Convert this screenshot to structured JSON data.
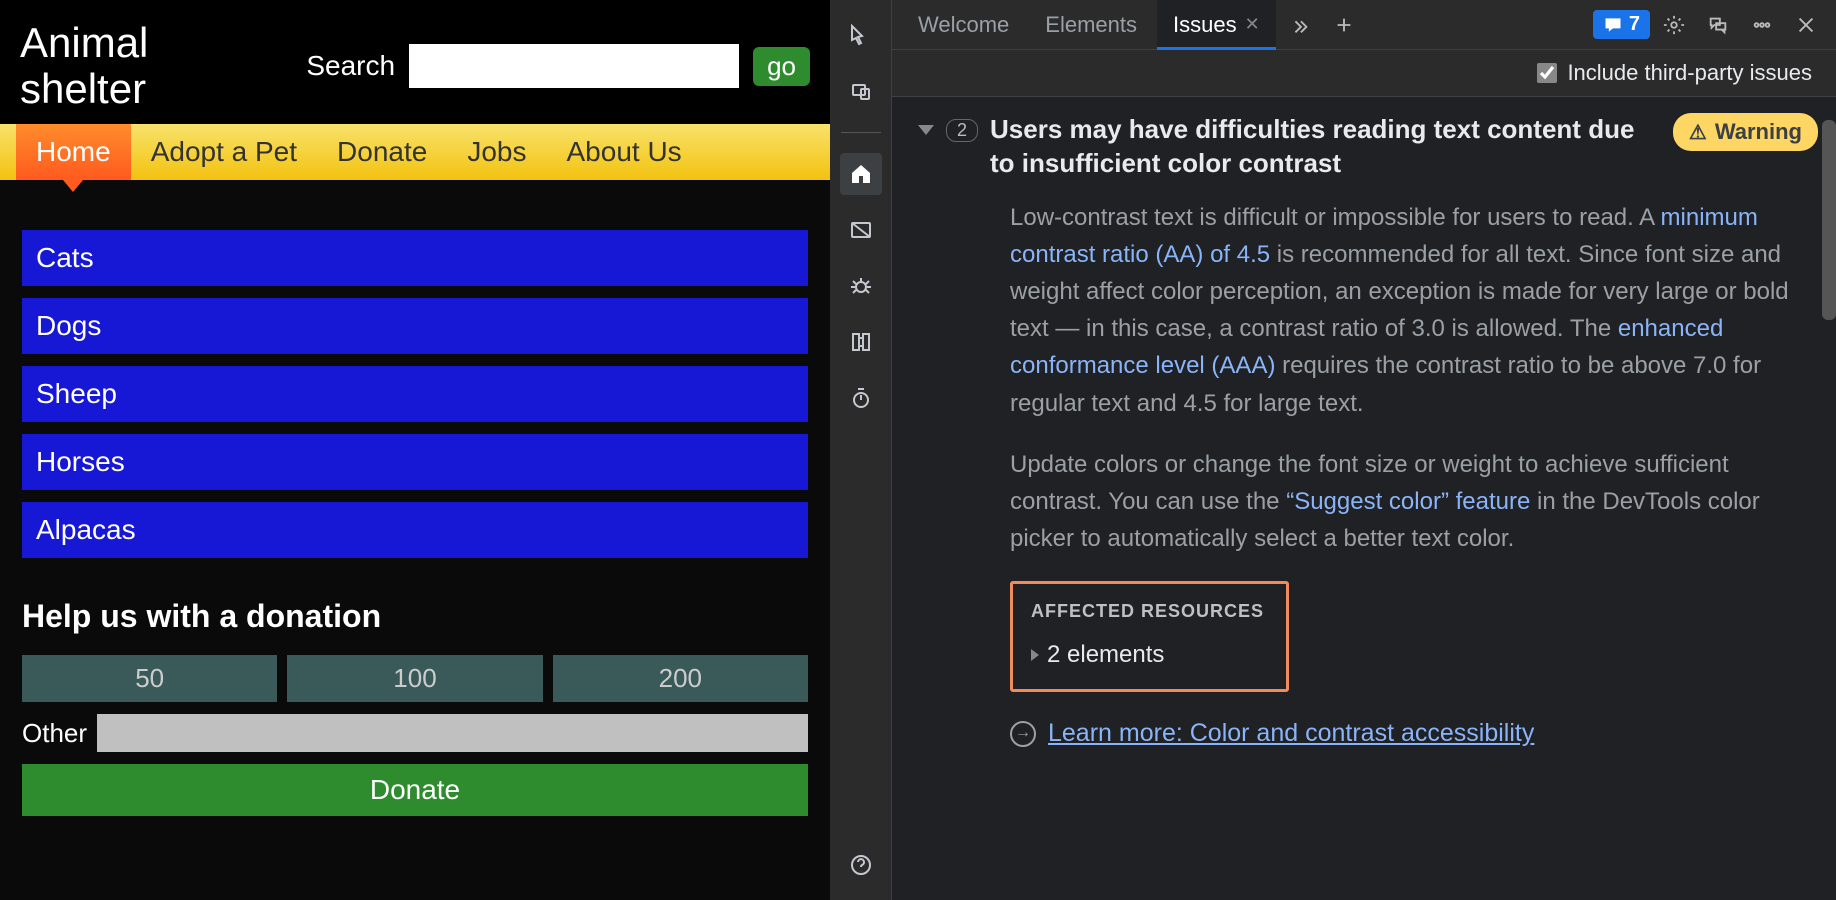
{
  "site": {
    "title_line1": "Animal",
    "title_line2": "shelter",
    "search_label": "Search",
    "go_label": "go"
  },
  "nav": [
    {
      "label": "Home",
      "active": true
    },
    {
      "label": "Adopt a Pet",
      "active": false
    },
    {
      "label": "Donate",
      "active": false
    },
    {
      "label": "Jobs",
      "active": false
    },
    {
      "label": "About Us",
      "active": false
    }
  ],
  "categories": [
    "Cats",
    "Dogs",
    "Sheep",
    "Horses",
    "Alpacas"
  ],
  "donation": {
    "heading": "Help us with a donation",
    "amounts": [
      "50",
      "100",
      "200"
    ],
    "other_label": "Other",
    "button": "Donate"
  },
  "devtools": {
    "tabs": [
      {
        "label": "Welcome",
        "active": false
      },
      {
        "label": "Elements",
        "active": false
      },
      {
        "label": "Issues",
        "active": true,
        "closable": true
      }
    ],
    "issue_count": "7",
    "toolbar": {
      "include_third_party": "Include third-party issues",
      "checked": true
    },
    "issue": {
      "count_badge": "2",
      "title": "Users may have difficulties reading text content due to insufficient color contrast",
      "severity": "Warning",
      "body1_a": "Low-contrast text is difficult or impossible for users to read. A ",
      "body1_link1": "minimum contrast ratio (AA) of 4.5",
      "body1_b": " is recommended for all text. Since font size and weight affect color perception, an exception is made for very large or bold text — in this case, a contrast ratio of 3.0 is allowed. The ",
      "body1_link2": "enhanced conformance level (AAA)",
      "body1_c": " requires the contrast ratio to be above 7.0 for regular text and 4.5 for large text.",
      "body2_a": "Update colors or change the font size or weight to achieve sufficient contrast. You can use the ",
      "body2_link": "“Suggest color” feature",
      "body2_b": " in the DevTools color picker to automatically select a better text color.",
      "affected_title": "AFFECTED RESOURCES",
      "affected_sub": "2 elements",
      "learn_more": "Learn more: Color and contrast accessibility"
    }
  }
}
